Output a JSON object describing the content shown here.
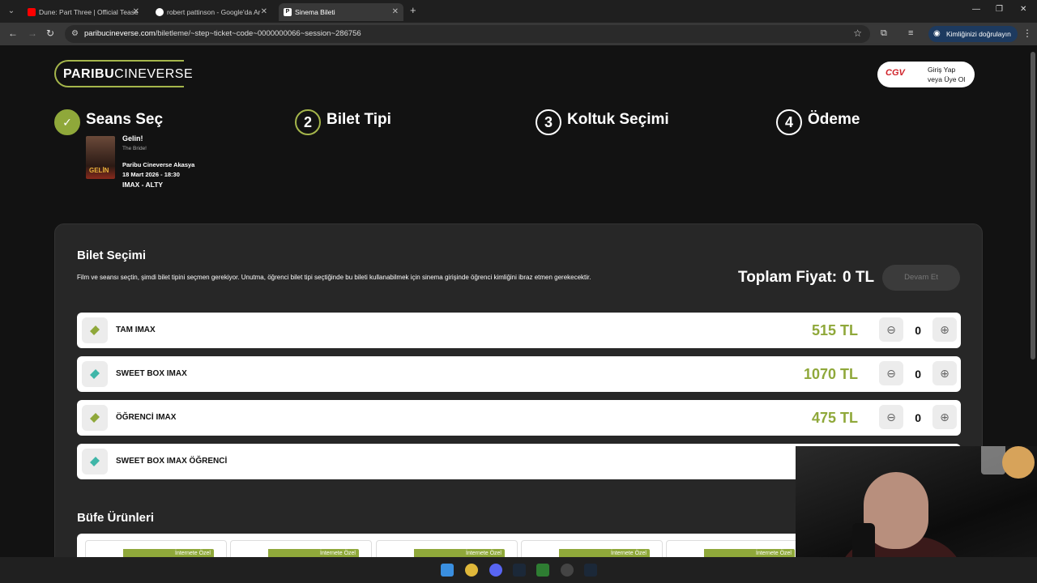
{
  "browser": {
    "tabs": [
      {
        "title": "Dune: Part Three | Official Tease",
        "favicon_color": "#ff0000"
      },
      {
        "title": "robert pattinson - Google'da Ar",
        "favicon_color": "#ffffff"
      },
      {
        "title": "Sinema Bileti",
        "favicon_color": "#ffffff",
        "favicon_letter": "P"
      }
    ],
    "url_host": "paribucineverse.com",
    "url_path": "/biletleme/~step~ticket~code~0000000066~session~286756",
    "verify_label": "Kimliğinizi doğrulayın"
  },
  "header": {
    "logo_part1": "PARIBU",
    "logo_part2": "CINEVERSE",
    "cgv": "CGV",
    "login_line1": "Giriş Yap",
    "login_line2": "veya Üye Ol"
  },
  "steps": [
    {
      "number": "✓",
      "label": "Seans Seç",
      "state": "done"
    },
    {
      "number": "2",
      "label": "Bilet Tipi",
      "state": "current"
    },
    {
      "number": "3",
      "label": "Koltuk Seçimi",
      "state": "todo"
    },
    {
      "number": "4",
      "label": "Ödeme",
      "state": "todo"
    }
  ],
  "movie": {
    "poster_text": "GELİN",
    "title": "Gelin!",
    "original_title": "The Bride!",
    "cinema": "Paribu Cineverse Akasya",
    "datetime": "18 Mart 2026 - 18:30",
    "format": "IMAX - ALTY"
  },
  "ticket_panel": {
    "title": "Bilet Seçimi",
    "description": "Film ve seansı seçtin, şimdi bilet tipini seçmen gerekiyor. Unutma, öğrenci bilet tipi seçtiğinde bu bileti kullanabilmek için sinema girişinde öğrenci kimliğini ibraz etmen gerekecektir.",
    "total_label": "Toplam Fiyat:",
    "total_value": "0 TL",
    "continue_label": "Devam Et",
    "tickets": [
      {
        "name": "TAM IMAX",
        "price": "515 TL",
        "qty": "0",
        "icon_color": "#8fa83a"
      },
      {
        "name": "SWEET BOX IMAX",
        "price": "1070 TL",
        "qty": "0",
        "icon_color": "#3fb6a8"
      },
      {
        "name": "ÖĞRENCİ IMAX",
        "price": "475 TL",
        "qty": "0",
        "icon_color": "#8fa83a"
      },
      {
        "name": "SWEET BOX IMAX ÖĞRENCİ",
        "price": "",
        "qty": "",
        "icon_color": "#3fb6a8"
      }
    ],
    "bufe_title": "Büfe Ürünleri",
    "bufe_badge": "İnternete Özel"
  }
}
